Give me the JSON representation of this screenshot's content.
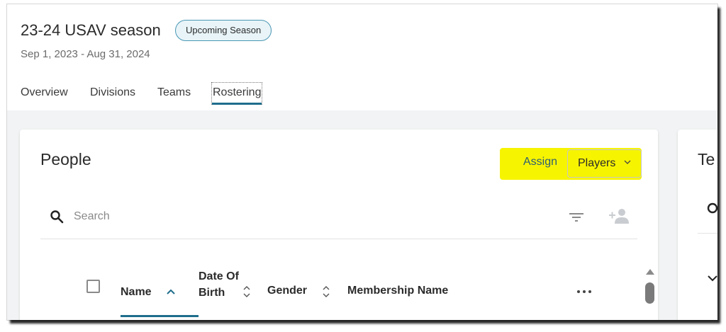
{
  "header": {
    "title": "23-24 USAV season",
    "badge": "Upcoming Season",
    "dates": "Sep 1, 2023 - Aug 31, 2024",
    "tabs": [
      {
        "label": "Overview"
      },
      {
        "label": "Divisions"
      },
      {
        "label": "Teams"
      },
      {
        "label": "Rostering"
      }
    ],
    "active_tab": "Rostering"
  },
  "people_panel": {
    "title": "People",
    "assign_label": "Assign",
    "assign_dropdown_value": "Players",
    "search_placeholder": "Search",
    "columns": [
      {
        "label": "Name",
        "sort": "ascending"
      },
      {
        "label": "Date Of Birth",
        "sort": "none"
      },
      {
        "label": "Gender",
        "sort": "none"
      },
      {
        "label": "Membership Name"
      }
    ]
  },
  "teams_panel": {
    "title_partial": "Te"
  },
  "colors": {
    "accent": "#1f6d8c",
    "badge_border": "#4a97b4",
    "badge_bg": "#e8f4f8",
    "highlight": "#f7f400",
    "page_bg": "#f1f3f4"
  },
  "icons": [
    "search-icon",
    "filter-icon",
    "add-person-icon",
    "chevron-down-icon",
    "sort-up-icon",
    "sort-both-icon",
    "more-icon"
  ]
}
